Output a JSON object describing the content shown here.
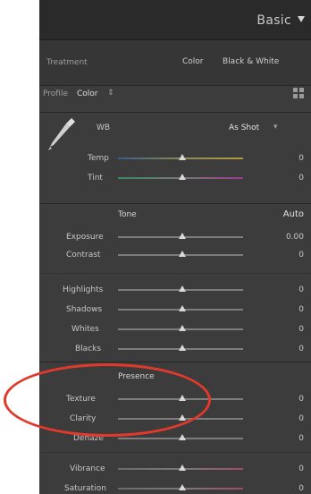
{
  "panel": {
    "title": "Basic",
    "treatment_label": "Treatment",
    "treatment_options": [
      "Color",
      "Black & White"
    ],
    "profile_label": "Profile",
    "profile_value": "Color",
    "wb_label": "WB",
    "wb_value": "As Shot",
    "tone_header": "Tone",
    "auto_label": "Auto",
    "presence_header": "Presence",
    "sliders": {
      "temp": {
        "label": "Temp",
        "value": "0"
      },
      "tint": {
        "label": "Tint",
        "value": "0"
      },
      "exposure": {
        "label": "Exposure",
        "value": "0.00"
      },
      "contrast": {
        "label": "Contrast",
        "value": "0"
      },
      "highlights": {
        "label": "Highlights",
        "value": "0"
      },
      "shadows": {
        "label": "Shadows",
        "value": "0"
      },
      "whites": {
        "label": "Whites",
        "value": "0"
      },
      "blacks": {
        "label": "Blacks",
        "value": "0"
      },
      "texture": {
        "label": "Texture",
        "value": "0"
      },
      "clarity": {
        "label": "Clarity",
        "value": "0"
      },
      "dehaze": {
        "label": "Dehaze",
        "value": "0"
      },
      "vibrance": {
        "label": "Vibrance",
        "value": "0"
      },
      "saturation": {
        "label": "Saturation",
        "value": "0"
      }
    }
  },
  "colors": {
    "panel_bg": "#3c3c3c",
    "header_bg": "#2a2a2a",
    "annotation": "#e13a2d"
  }
}
